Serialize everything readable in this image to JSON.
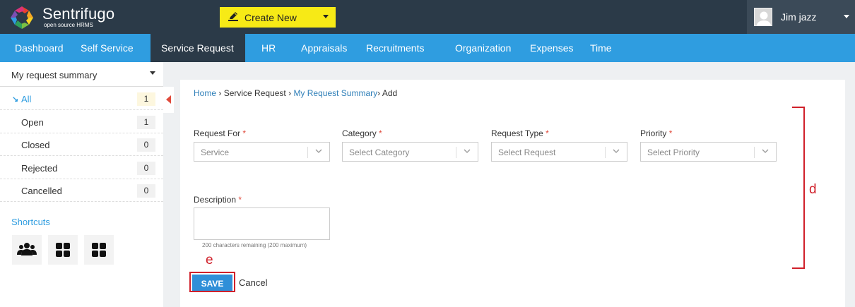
{
  "header": {
    "brand": "Sentrifugo",
    "brand_sub": "open source HRMS",
    "create_new": "Create New",
    "user_name": "Jim jazz"
  },
  "nav": {
    "items": [
      "Dashboard",
      "Self Service",
      "Service Request",
      "HR",
      "Appraisals",
      "Recruitments",
      "Organization",
      "Expenses",
      "Time"
    ],
    "active": "Service Request"
  },
  "sidebar": {
    "summary_label": "My request summary",
    "items": [
      {
        "label": "All",
        "count": "1"
      },
      {
        "label": "Open",
        "count": "1"
      },
      {
        "label": "Closed",
        "count": "0"
      },
      {
        "label": "Rejected",
        "count": "0"
      },
      {
        "label": "Cancelled",
        "count": "0"
      }
    ],
    "shortcuts_title": "Shortcuts",
    "shortcut_icons": [
      "group-icon",
      "grid-icon",
      "grid-icon"
    ]
  },
  "breadcrumb": {
    "home": "Home",
    "sep": "›",
    "service_request": "Service Request",
    "my_request_summary": "My Request Summary",
    "current": "Add"
  },
  "form": {
    "request_for": {
      "label": "Request For",
      "value": "Service"
    },
    "category": {
      "label": "Category",
      "value": "Select Category"
    },
    "request_type": {
      "label": "Request Type",
      "value": "Select Request"
    },
    "priority": {
      "label": "Priority",
      "value": "Select Priority"
    },
    "description": {
      "label": "Description",
      "value": "",
      "hint": "200 characters remaining (200 maximum)"
    },
    "required_mark": "*",
    "save": "SAVE",
    "cancel": "Cancel"
  },
  "annotations": {
    "save_marker": "e",
    "form_marker": "d",
    "color": "#d0202a"
  },
  "colors": {
    "topbar": "#2b3a48",
    "nav": "#2f9de0",
    "create_new": "#f7ea16",
    "save_button": "#2f8fd8"
  }
}
